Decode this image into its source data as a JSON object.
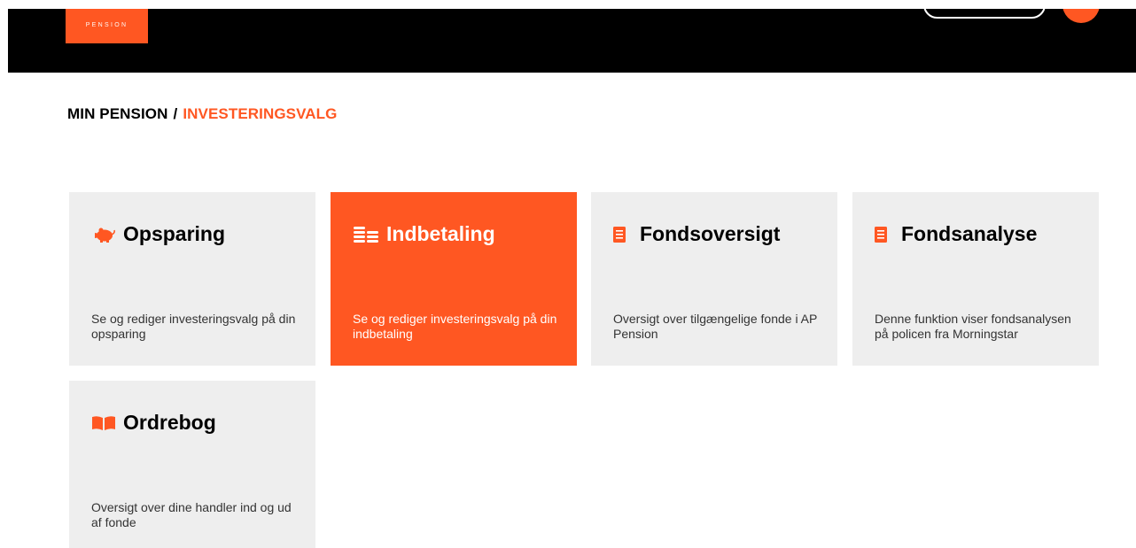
{
  "header": {
    "logo_text": "PENSION",
    "brand_color": "#ff5722"
  },
  "breadcrumb": {
    "root": "MIN PENSION",
    "separator": "/",
    "current": "INVESTERINGSVALG"
  },
  "tiles": [
    {
      "title": "Opsparing",
      "icon": "piggy-bank-icon",
      "description": "Se og rediger investeringsvalg på din opsparing",
      "active": false
    },
    {
      "title": "Indbetaling",
      "icon": "coins-icon",
      "description": "Se og rediger investeringsvalg på din indbetaling",
      "active": true
    },
    {
      "title": "Fondsoversigt",
      "icon": "document-icon",
      "description": "Oversigt over tilgængelige fonde i AP Pension",
      "active": false
    },
    {
      "title": "Fondsanalyse",
      "icon": "document-icon",
      "description": "Denne funktion viser fondsanalysen på policen fra Morningstar",
      "active": false
    },
    {
      "title": "Ordrebog",
      "icon": "open-book-icon",
      "description": "Oversigt over dine handler ind og ud af fonde",
      "active": false
    }
  ],
  "colors": {
    "accent": "#ff5722",
    "tile_background": "#eeeeee",
    "header_background": "#000000"
  }
}
